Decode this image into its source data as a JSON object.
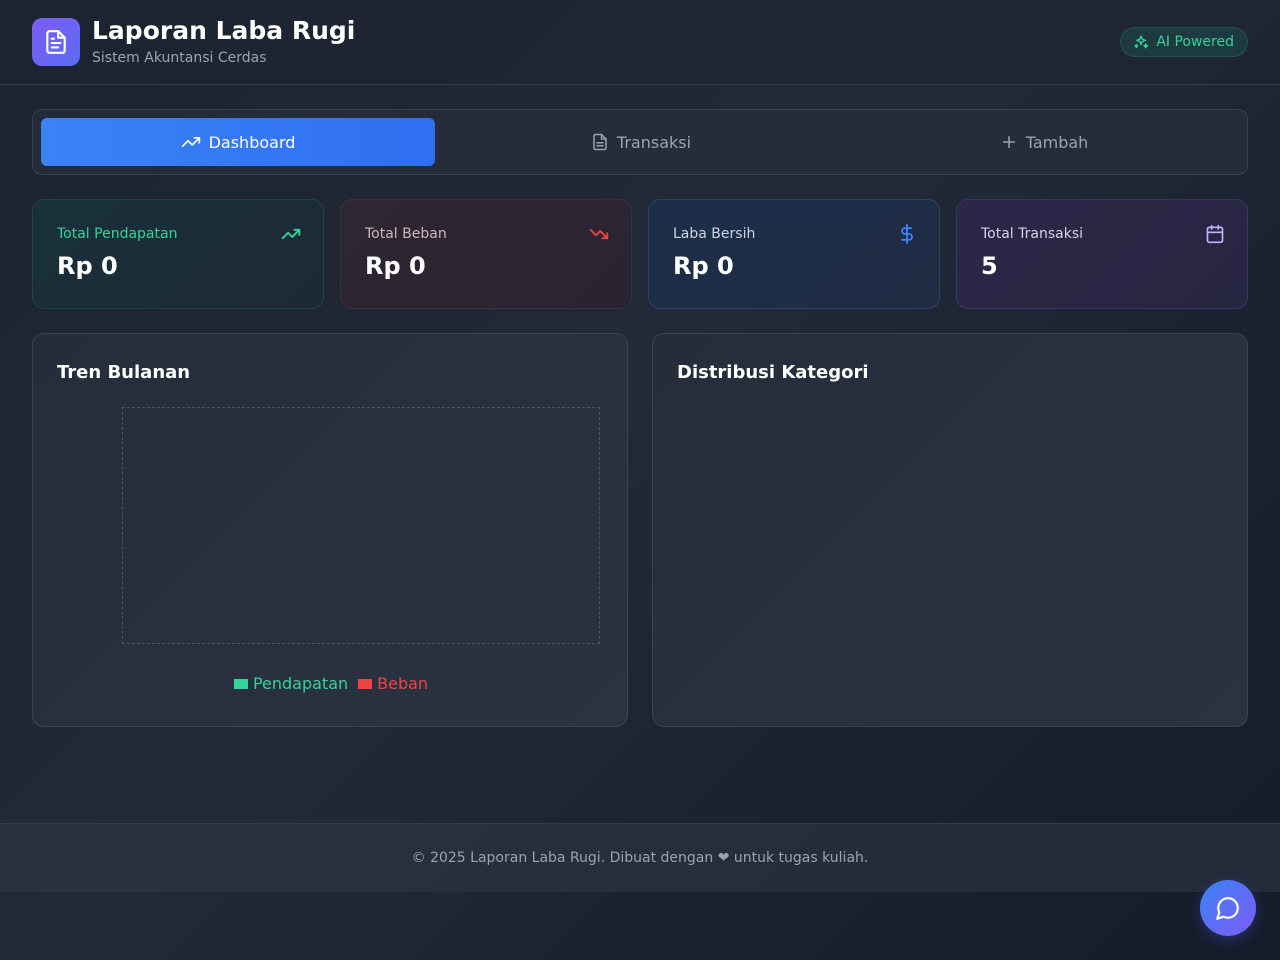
{
  "header": {
    "title": "Laporan Laba Rugi",
    "subtitle": "Sistem Akuntansi Cerdas",
    "logo_icon": "document-icon",
    "badge": {
      "label": "AI Powered",
      "icon": "sparkles-icon"
    }
  },
  "tabs": [
    {
      "label": "Dashboard",
      "icon": "trending-up-icon",
      "active": true
    },
    {
      "label": "Transaksi",
      "icon": "document-icon",
      "active": false
    },
    {
      "label": "Tambah",
      "icon": "plus-icon",
      "active": false
    }
  ],
  "stats": [
    {
      "label": "Total Pendapatan",
      "value": "Rp 0",
      "icon": "trending-up-icon",
      "color": "#34d399"
    },
    {
      "label": "Total Beban",
      "value": "Rp 0",
      "icon": "trending-down-icon",
      "color": "#ef4444"
    },
    {
      "label": "Laba Bersih",
      "value": "Rp 0",
      "icon": "dollar-icon",
      "color": "#3b82f6"
    },
    {
      "label": "Total Transaksi",
      "value": "5",
      "icon": "calendar-icon",
      "color": "#c4b5fd"
    }
  ],
  "panels": {
    "trend_title": "Tren Bulanan",
    "distribution_title": "Distribusi Kategori"
  },
  "chart_data": {
    "type": "bar",
    "categories": [],
    "series": [
      {
        "name": "Pendapatan",
        "values": [],
        "color": "#34d399"
      },
      {
        "name": "Beban",
        "values": [],
        "color": "#ef4444"
      }
    ],
    "title": "",
    "xlabel": "",
    "ylabel": "",
    "legend": "bottom"
  },
  "footer": {
    "text": "© 2025 Laporan Laba Rugi. Dibuat dengan ❤ untuk tugas kuliah."
  },
  "fab": {
    "icon": "chat-icon"
  }
}
